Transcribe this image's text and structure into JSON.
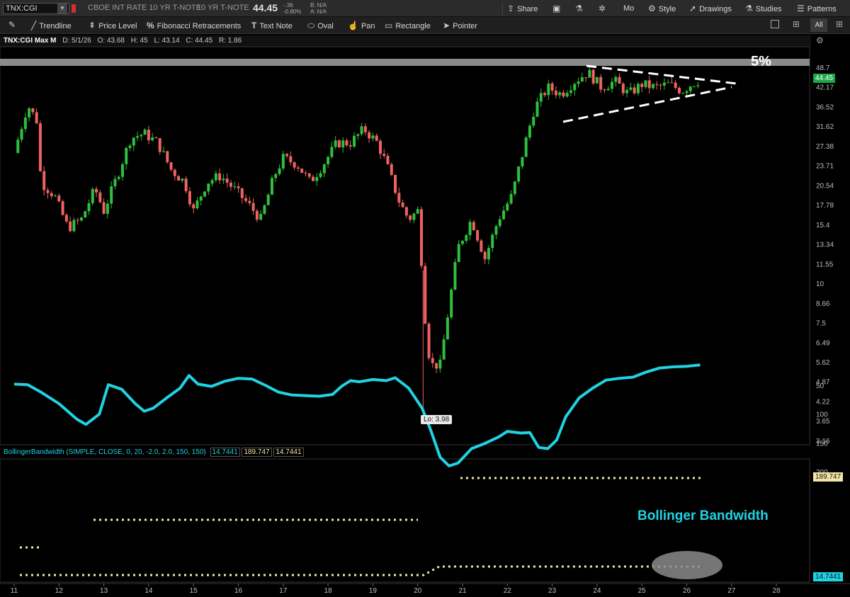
{
  "header": {
    "symbol": "TNX:CGI",
    "description": "CBOE INT RATE 10 YR T-NOTE",
    "short_desc": "10 YR T-NOTE",
    "last": "44.45",
    "change": "-.36",
    "change_pct": "-0.80%",
    "bid": "B: N/A",
    "ask": "A: N/A"
  },
  "topbar_buttons": {
    "share": "Share",
    "period": "Mo",
    "style": "Style",
    "drawings": "Drawings",
    "studies": "Studies",
    "patterns": "Patterns"
  },
  "drawing_tools": {
    "trendline": "Trendline",
    "price_level": "Price Level",
    "fibonacci": "Fibonacci Retracements",
    "text_note": "Text Note",
    "oval": "Oval",
    "pan": "Pan",
    "rectangle": "Rectangle",
    "pointer": "Pointer",
    "all": "All"
  },
  "info": {
    "title": "TNX:CGI Max M",
    "date": "D: 5/1/26",
    "open": "O: 43.68",
    "high": "H: 45",
    "low": "L: 43.14",
    "close": "C: 44.45",
    "range": "R: 1.86"
  },
  "indicator": {
    "label": "BollingerBandwidth (SIMPLE, CLOSE, 0, 20, -2.0, 2.0, 150, 150)",
    "value1": "14.7441",
    "value2": "189.747",
    "value3": "14.7441"
  },
  "annotations": {
    "five_pct": "5%",
    "bandwidth_title": "Bollinger Bandwidth",
    "low_label": "Lo: 3.98"
  },
  "colors": {
    "up": "#2fbf3c",
    "down": "#f06262",
    "bandwidth": "#1fd3e3",
    "dotted": "#f3e6a4",
    "background": "#000000",
    "price_tag": "#1fa84a"
  },
  "chart_data": [
    {
      "type": "candlestick",
      "title": "TNX:CGI Max M",
      "scale": "log",
      "y_ticks": [
        "48.7",
        "42.17",
        "36.52",
        "31.62",
        "27.38",
        "23.71",
        "20.54",
        "17.78",
        "15.4",
        "13.34",
        "11.55",
        "10",
        "8.66",
        "7.5",
        "6.49",
        "5.62",
        "4.87",
        "4.22",
        "3.65",
        "3.16"
      ],
      "x_ticks": [
        "11",
        "12",
        "13",
        "14",
        "15",
        "16",
        "17",
        "18",
        "19",
        "20",
        "21",
        "22",
        "23",
        "24",
        "25",
        "26",
        "27",
        "28"
      ],
      "last_price": "44.45",
      "low": 3.98,
      "close_path": [
        {
          "x": 11.0,
          "y": 26
        },
        {
          "x": 11.3,
          "y": 37
        },
        {
          "x": 11.5,
          "y": 33
        },
        {
          "x": 11.6,
          "y": 21
        },
        {
          "x": 11.9,
          "y": 19
        },
        {
          "x": 12.2,
          "y": 15
        },
        {
          "x": 12.5,
          "y": 16
        },
        {
          "x": 12.8,
          "y": 20
        },
        {
          "x": 13.0,
          "y": 17
        },
        {
          "x": 13.3,
          "y": 22
        },
        {
          "x": 13.6,
          "y": 29
        },
        {
          "x": 13.9,
          "y": 30
        },
        {
          "x": 14.2,
          "y": 28
        },
        {
          "x": 14.5,
          "y": 23
        },
        {
          "x": 14.8,
          "y": 21
        },
        {
          "x": 15.0,
          "y": 17
        },
        {
          "x": 15.3,
          "y": 21
        },
        {
          "x": 15.6,
          "y": 22
        },
        {
          "x": 15.9,
          "y": 20
        },
        {
          "x": 16.2,
          "y": 18
        },
        {
          "x": 16.5,
          "y": 16
        },
        {
          "x": 16.8,
          "y": 22
        },
        {
          "x": 17.0,
          "y": 25
        },
        {
          "x": 17.3,
          "y": 24
        },
        {
          "x": 17.6,
          "y": 21
        },
        {
          "x": 17.9,
          "y": 24
        },
        {
          "x": 18.2,
          "y": 28
        },
        {
          "x": 18.5,
          "y": 28
        },
        {
          "x": 18.8,
          "y": 31
        },
        {
          "x": 19.1,
          "y": 28
        },
        {
          "x": 19.3,
          "y": 24
        },
        {
          "x": 19.6,
          "y": 18
        },
        {
          "x": 19.8,
          "y": 16
        },
        {
          "x": 20.0,
          "y": 17
        },
        {
          "x": 20.1,
          "y": 11
        },
        {
          "x": 20.2,
          "y": 6.5
        },
        {
          "x": 20.3,
          "y": 5.5
        },
        {
          "x": 20.5,
          "y": 5.5
        },
        {
          "x": 20.7,
          "y": 8.5
        },
        {
          "x": 20.9,
          "y": 13
        },
        {
          "x": 21.2,
          "y": 16
        },
        {
          "x": 21.5,
          "y": 12
        },
        {
          "x": 21.8,
          "y": 16
        },
        {
          "x": 22.1,
          "y": 19
        },
        {
          "x": 22.4,
          "y": 28
        },
        {
          "x": 22.6,
          "y": 36
        },
        {
          "x": 22.9,
          "y": 42
        },
        {
          "x": 23.2,
          "y": 40
        },
        {
          "x": 23.5,
          "y": 44
        },
        {
          "x": 23.8,
          "y": 47
        },
        {
          "x": 24.1,
          "y": 42
        },
        {
          "x": 24.4,
          "y": 44
        },
        {
          "x": 24.7,
          "y": 40
        },
        {
          "x": 25.0,
          "y": 43
        },
        {
          "x": 25.3,
          "y": 42
        },
        {
          "x": 25.6,
          "y": 43
        },
        {
          "x": 25.9,
          "y": 41
        },
        {
          "x": 26.1,
          "y": 43
        },
        {
          "x": 26.3,
          "y": 44.45
        }
      ]
    },
    {
      "type": "line",
      "title": "BollingerBandwidth (SIMPLE, CLOSE, 0, 20, -2.0, 2.0, 150, 150)",
      "y_ticks": [
        "200",
        "150",
        "100",
        "50"
      ],
      "x_ticks": [
        "11",
        "12",
        "13",
        "14",
        "15",
        "16",
        "17",
        "18",
        "19",
        "20",
        "21",
        "22",
        "23",
        "24",
        "25",
        "26",
        "27",
        "28"
      ],
      "series": [
        {
          "values": [
            {
              "x": 11.0,
              "y": 48
            },
            {
              "x": 11.3,
              "y": 49
            },
            {
              "x": 11.6,
              "y": 62
            },
            {
              "x": 12.0,
              "y": 82
            },
            {
              "x": 12.4,
              "y": 109
            },
            {
              "x": 12.6,
              "y": 118
            },
            {
              "x": 12.9,
              "y": 100
            },
            {
              "x": 13.1,
              "y": 49
            },
            {
              "x": 13.4,
              "y": 57
            },
            {
              "x": 13.7,
              "y": 82
            },
            {
              "x": 13.9,
              "y": 95
            },
            {
              "x": 14.1,
              "y": 90
            },
            {
              "x": 14.4,
              "y": 72
            },
            {
              "x": 14.7,
              "y": 55
            },
            {
              "x": 14.9,
              "y": 33
            },
            {
              "x": 15.1,
              "y": 48
            },
            {
              "x": 15.4,
              "y": 52
            },
            {
              "x": 15.7,
              "y": 43
            },
            {
              "x": 16.0,
              "y": 38
            },
            {
              "x": 16.3,
              "y": 39
            },
            {
              "x": 16.6,
              "y": 50
            },
            {
              "x": 16.9,
              "y": 62
            },
            {
              "x": 17.2,
              "y": 67
            },
            {
              "x": 17.5,
              "y": 68
            },
            {
              "x": 17.8,
              "y": 69
            },
            {
              "x": 18.1,
              "y": 66
            },
            {
              "x": 18.3,
              "y": 52
            },
            {
              "x": 18.5,
              "y": 42
            },
            {
              "x": 18.7,
              "y": 44
            },
            {
              "x": 19.0,
              "y": 40
            },
            {
              "x": 19.3,
              "y": 42
            },
            {
              "x": 19.5,
              "y": 37
            },
            {
              "x": 19.8,
              "y": 55
            },
            {
              "x": 20.1,
              "y": 90
            },
            {
              "x": 20.3,
              "y": 130
            },
            {
              "x": 20.5,
              "y": 175
            },
            {
              "x": 20.7,
              "y": 190
            },
            {
              "x": 20.9,
              "y": 185
            },
            {
              "x": 21.2,
              "y": 160
            },
            {
              "x": 21.5,
              "y": 151
            },
            {
              "x": 21.8,
              "y": 140
            },
            {
              "x": 22.0,
              "y": 130
            },
            {
              "x": 22.3,
              "y": 133
            },
            {
              "x": 22.5,
              "y": 132
            },
            {
              "x": 22.7,
              "y": 158
            },
            {
              "x": 22.9,
              "y": 160
            },
            {
              "x": 23.1,
              "y": 145
            },
            {
              "x": 23.3,
              "y": 105
            },
            {
              "x": 23.6,
              "y": 72
            },
            {
              "x": 23.9,
              "y": 55
            },
            {
              "x": 24.2,
              "y": 41
            },
            {
              "x": 24.5,
              "y": 38
            },
            {
              "x": 24.8,
              "y": 36
            },
            {
              "x": 25.1,
              "y": 27
            },
            {
              "x": 25.4,
              "y": 20
            },
            {
              "x": 25.7,
              "y": 18
            },
            {
              "x": 26.0,
              "y": 17
            },
            {
              "x": 26.3,
              "y": 14.7441
            }
          ]
        }
      ],
      "levels": [
        {
          "y": 189.747,
          "label": "189.747"
        },
        {
          "y": 14.7441,
          "label": "14.7441"
        }
      ]
    }
  ]
}
